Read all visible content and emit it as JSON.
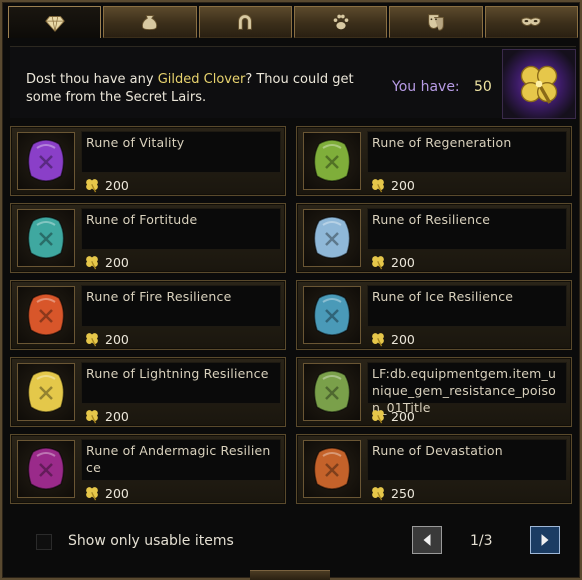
{
  "tabs": [
    {
      "icon": "gem-icon",
      "active": true
    },
    {
      "icon": "pouch-icon",
      "active": false
    },
    {
      "icon": "horseshoe-icon",
      "active": false
    },
    {
      "icon": "paw-icon",
      "active": false
    },
    {
      "icon": "theater-mask-icon",
      "active": false
    },
    {
      "icon": "eye-mask-icon",
      "active": false
    }
  ],
  "info": {
    "text_before": "Dost thou have any ",
    "currency_name": "Gilded Clover",
    "text_after": "? Thou could get some from the Secret Lairs.",
    "have_label": "You have:",
    "have_value": "50"
  },
  "items": [
    {
      "name": "Rune of Vitality",
      "price": "200",
      "color": "#8a3fc8"
    },
    {
      "name": "Rune of Regeneration",
      "price": "200",
      "color": "#7fae3a"
    },
    {
      "name": "Rune of Fortitude",
      "price": "200",
      "color": "#3fa8a0"
    },
    {
      "name": "Rune of Resilience",
      "price": "200",
      "color": "#8fb8d8"
    },
    {
      "name": "Rune of Fire Resilience",
      "price": "200",
      "color": "#d8562a"
    },
    {
      "name": "Rune of Ice Resilience",
      "price": "200",
      "color": "#4a9ab8"
    },
    {
      "name": "Rune of Lightning Resilience",
      "price": "200",
      "color": "#e4c84a"
    },
    {
      "name": "LF:db.equipmentgem.item_unique_gem_resistance_poison_01Title",
      "price": "200",
      "color": "#7aa04a"
    },
    {
      "name": "Rune of Andermagic Resilience",
      "price": "200",
      "color": "#9a2a8a"
    },
    {
      "name": "Rune of Devastation",
      "price": "250",
      "color": "#c4622a"
    }
  ],
  "footer": {
    "checkbox_label": "Show only usable items",
    "page": "1/3"
  },
  "colors": {
    "accent_gold": "#e8d36e",
    "have_label": "#b79be5",
    "clover": "#e6c74a"
  }
}
